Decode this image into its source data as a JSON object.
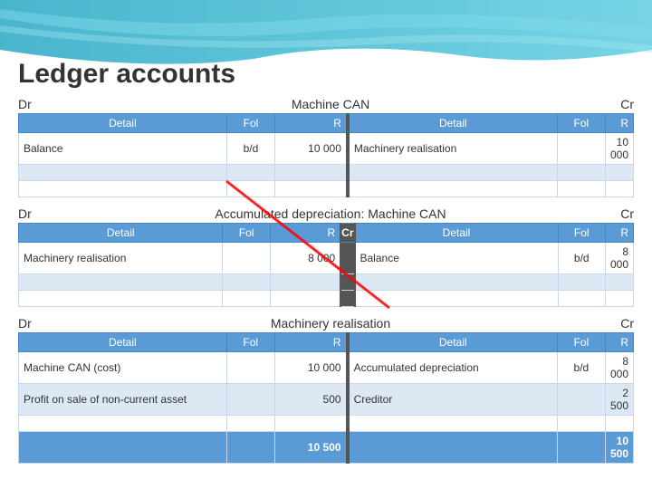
{
  "page": {
    "title": "Ledger accounts"
  },
  "machine_can": {
    "dr": "Dr",
    "cr": "Cr",
    "title": "Machine CAN",
    "headers": {
      "detail": "Detail",
      "fol": "Fol",
      "r": "R",
      "detail2": "Detail",
      "fol2": "Fol",
      "r2": "R"
    },
    "rows": [
      {
        "detail": "Balance",
        "fol": "b/d",
        "r": "10 000",
        "detail2": "Machinery realisation",
        "fol2": "",
        "r2": "10 000"
      },
      {
        "detail": "",
        "fol": "",
        "r": "",
        "detail2": "",
        "fol2": "",
        "r2": ""
      },
      {
        "detail": "",
        "fol": "",
        "r": "",
        "detail2": "",
        "fol2": "",
        "r2": ""
      }
    ]
  },
  "accum_depr": {
    "dr": "Dr",
    "cr": "Cr",
    "title": "Accumulated depreciation: Machine CAN",
    "headers": {
      "detail": "Detail",
      "fol": "Fol",
      "r": "R",
      "cr_label": "Cr",
      "detail2": "Detail",
      "fol2": "Fol",
      "r2": "R"
    },
    "rows": [
      {
        "detail": "Machinery realisation",
        "fol": "",
        "r": "8 000",
        "detail2": "Balance",
        "fol2": "b/d",
        "r2": "8 000"
      },
      {
        "detail": "",
        "fol": "",
        "r": "",
        "detail2": "",
        "fol2": "",
        "r2": ""
      },
      {
        "detail": "",
        "fol": "",
        "r": "",
        "detail2": "",
        "fol2": "",
        "r2": ""
      }
    ]
  },
  "machinery_realisation": {
    "dr": "Dr",
    "cr": "Cr",
    "title": "Machinery realisation",
    "headers": {
      "detail": "Detail",
      "fol": "Fol",
      "r": "R",
      "detail2": "Detail",
      "fol2": "Fol",
      "r2": "R"
    },
    "rows": [
      {
        "detail": "Machine CAN (cost)",
        "fol": "",
        "r": "10 000",
        "detail2": "Accumulated depreciation",
        "fol2": "b/d",
        "r2": "8 000"
      },
      {
        "detail": "Profit on sale of non-current asset",
        "fol": "",
        "r": "500",
        "detail2": "Creditor",
        "fol2": "",
        "r2": "2 500"
      },
      {
        "detail": "",
        "fol": "",
        "r": "",
        "detail2": "",
        "fol2": "",
        "r2": ""
      }
    ],
    "total_row": {
      "detail": "",
      "fol": "",
      "r": "10 500",
      "detail2": "",
      "fol2": "",
      "r2": "10 500"
    }
  }
}
